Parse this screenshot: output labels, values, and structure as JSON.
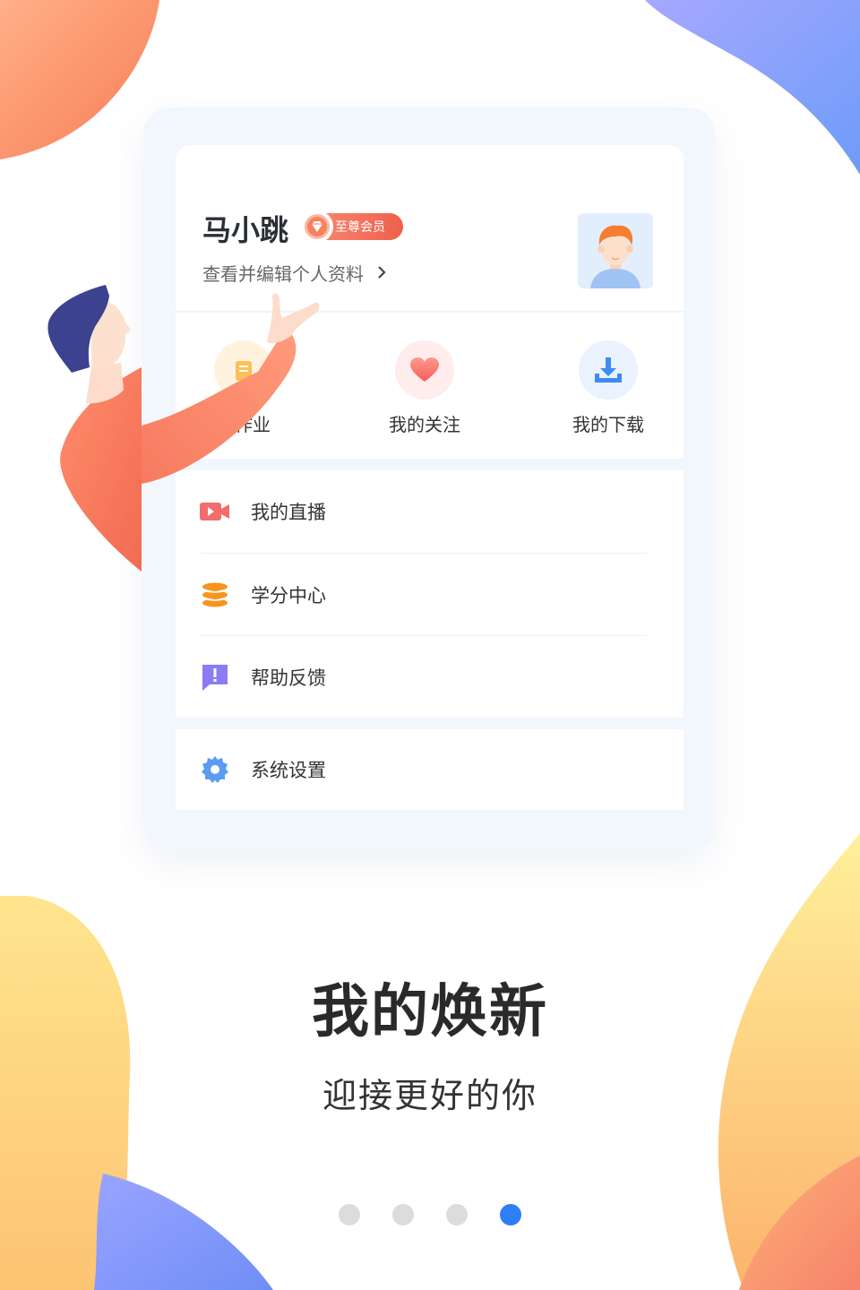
{
  "profile": {
    "name": "马小跳",
    "vip_label": "至尊会员",
    "edit_link": "查看并编辑个人资料"
  },
  "quick_actions": [
    {
      "label": "的作业",
      "icon": "homework-icon"
    },
    {
      "label": "我的关注",
      "icon": "heart-icon"
    },
    {
      "label": "我的下载",
      "icon": "download-icon"
    }
  ],
  "menu": {
    "items": [
      {
        "label": "我的直播",
        "icon": "live-video-icon"
      },
      {
        "label": "学分中心",
        "icon": "credits-stack-icon"
      },
      {
        "label": "帮助反馈",
        "icon": "feedback-icon"
      }
    ],
    "settings": {
      "label": "系统设置",
      "icon": "gear-icon"
    }
  },
  "onboarding": {
    "title": "我的焕新",
    "subtitle": "迎接更好的你",
    "pages": 4,
    "active_page": 4
  },
  "colors": {
    "accent_blue": "#2e7ff5",
    "vip_orange": "#ef5f4e",
    "live_red": "#f36d6d",
    "credits_orange": "#f7941d",
    "feedback_purple": "#8b7cf6",
    "settings_blue": "#5b9cf2"
  }
}
